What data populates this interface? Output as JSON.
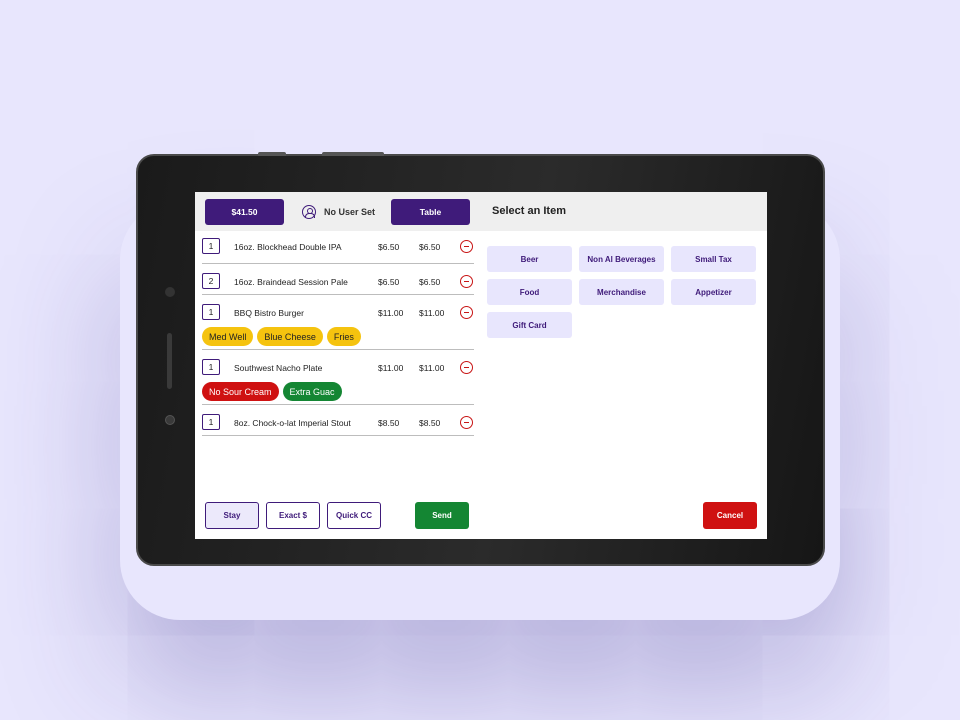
{
  "header": {
    "total": "$41.50",
    "user": "No User Set",
    "table_label": "Table",
    "select_title": "Select an Item"
  },
  "order": {
    "items": [
      {
        "qty": "1",
        "name": "16oz. Blockhead Double IPA",
        "price": "$6.50",
        "total": "$6.50",
        "mods": []
      },
      {
        "qty": "2",
        "name": "16oz. Braindead Session Pale",
        "price": "$6.50",
        "total": "$6.50",
        "mods": []
      },
      {
        "qty": "1",
        "name": "BBQ Bistro Burger",
        "price": "$11.00",
        "total": "$11.00",
        "mods": [
          {
            "label": "Med Well",
            "color": "yellow"
          },
          {
            "label": "Blue Cheese",
            "color": "yellow"
          },
          {
            "label": "Fries",
            "color": "yellow"
          }
        ]
      },
      {
        "qty": "1",
        "name": "Southwest Nacho Plate",
        "price": "$11.00",
        "total": "$11.00",
        "mods": [
          {
            "label": "No Sour Cream",
            "color": "red"
          },
          {
            "label": "Extra Guac",
            "color": "green"
          }
        ]
      },
      {
        "qty": "1",
        "name": "8oz. Chock-o-lat Imperial Stout",
        "price": "$8.50",
        "total": "$8.50",
        "mods": []
      }
    ]
  },
  "categories": [
    "Beer",
    "Non Al Beverages",
    "Small Tax",
    "Food",
    "Merchandise",
    "Appetizer",
    "Gift Card"
  ],
  "actions": {
    "stay": "Stay",
    "exact": "Exact $",
    "quick_cc": "Quick CC",
    "send": "Send",
    "cancel": "Cancel"
  },
  "colors": {
    "brand": "#3f1b7a",
    "category_bg": "#e8e6fd",
    "send": "#148633",
    "cancel": "#cf1111",
    "mod_yellow": "#f5c30f",
    "mod_red": "#cf1111",
    "mod_green": "#148633"
  },
  "icons": {
    "user": "user-circle-icon",
    "remove": "remove-circle-icon"
  }
}
